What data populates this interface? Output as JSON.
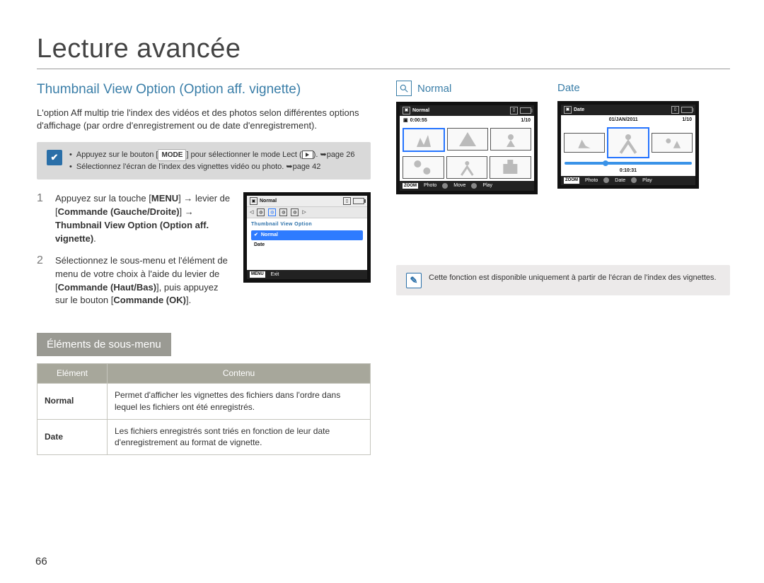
{
  "page": {
    "title": "Lecture avancée",
    "number": "66"
  },
  "left": {
    "heading": "Thumbnail View Option (Option aff. vignette)",
    "intro": "L'option Aff multip trie l'index des vidéos et des photos selon différentes options d'affichage (par ordre d'enregistrement ou de date d'enregistrement).",
    "info": {
      "bullet1_pre": "Appuyez sur le bouton [",
      "bullet1_mode": "MODE",
      "bullet1_post": "] pour sélectionner le mode Lect (",
      "bullet1_ref": "). ➥page 26",
      "bullet2": "Sélectionnez l'écran de l'index des vignettes vidéo ou photo. ➥page 42"
    },
    "steps": {
      "s1_num": "1",
      "s1_a": "Appuyez sur la touche [",
      "s1_menu": "MENU",
      "s1_b": "] → levier de [",
      "s1_cmd1": "Commande (Gauche/Droite)",
      "s1_c": "] → ",
      "s1_opt": "Thumbnail View Option (Option aff. vignette)",
      "s1_d": ".",
      "s2_num": "2",
      "s2_a": "Sélectionnez le sous-menu et l'élément de menu de votre choix à l'aide du levier de [",
      "s2_cmd": "Commande (Haut/Bas)",
      "s2_b": "], puis appuyez sur le bouton [",
      "s2_ok": "Commande (OK)",
      "s2_c": "]."
    },
    "lcd_menu": {
      "header": "Normal",
      "title": "Thumbnail View Option",
      "item1": "Normal",
      "item2": "Date",
      "footer_btn": "MENU",
      "footer_exit": "Exit"
    },
    "sub_header": "Éléments de sous-menu",
    "table": {
      "h1": "Elément",
      "h2": "Contenu",
      "r1c1": "Normal",
      "r1c2": "Permet d'afficher les vignettes des fichiers dans l'ordre dans lequel les fichiers ont été enregistrés.",
      "r2c1": "Date",
      "r2c2": "Les fichiers enregistrés sont triés en fonction de leur date d'enregistrement au format de vignette."
    }
  },
  "right": {
    "label_normal": "Normal",
    "label_date": "Date",
    "lcd_normal": {
      "header": "Normal",
      "time_left": "0:00:55",
      "time_right": "1/10",
      "footer_zoom": "ZOOM",
      "footer_photo": "Photo",
      "footer_move": "Move",
      "footer_play": "Play"
    },
    "lcd_date": {
      "header": "Date",
      "date_left": "01/JAN/2011",
      "date_right": "1/10",
      "time_center": "0:10:31",
      "footer_zoom": "ZOOM",
      "footer_photo": "Photo",
      "footer_date": "Date",
      "footer_play": "Play"
    },
    "note": "Cette fonction est disponible uniquement à partir de l'écran de l'index des vignettes."
  }
}
